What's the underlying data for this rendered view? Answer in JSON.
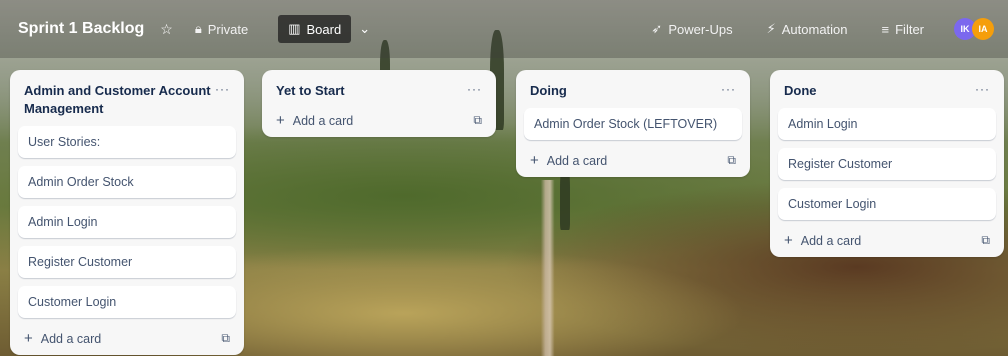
{
  "header": {
    "board_title": "Sprint 1 Backlog",
    "star_icon": "star-icon",
    "visibility_label": "Private",
    "view_label": "Board",
    "powerups_label": "Power-Ups",
    "automation_label": "Automation",
    "filter_label": "Filter",
    "avatars": [
      {
        "initials": "IK",
        "color": "#7b68ee"
      },
      {
        "initials": "IA",
        "color": "#f59e0b"
      }
    ]
  },
  "lists": [
    {
      "title": "Admin and Customer Account Management",
      "cards": [
        "User Stories:",
        "Admin Order Stock",
        "Admin Login",
        "Register Customer",
        "Customer Login"
      ],
      "add_label": "Add a card"
    },
    {
      "title": "Yet to Start",
      "cards": [],
      "add_label": "Add a card"
    },
    {
      "title": "Doing",
      "cards": [
        "Admin Order Stock (LEFTOVER)"
      ],
      "add_label": "Add a card"
    },
    {
      "title": "Done",
      "cards": [
        "Admin Login",
        "Register Customer",
        "Customer Login"
      ],
      "add_label": "Add a card"
    }
  ],
  "list_menu_glyph": "···"
}
